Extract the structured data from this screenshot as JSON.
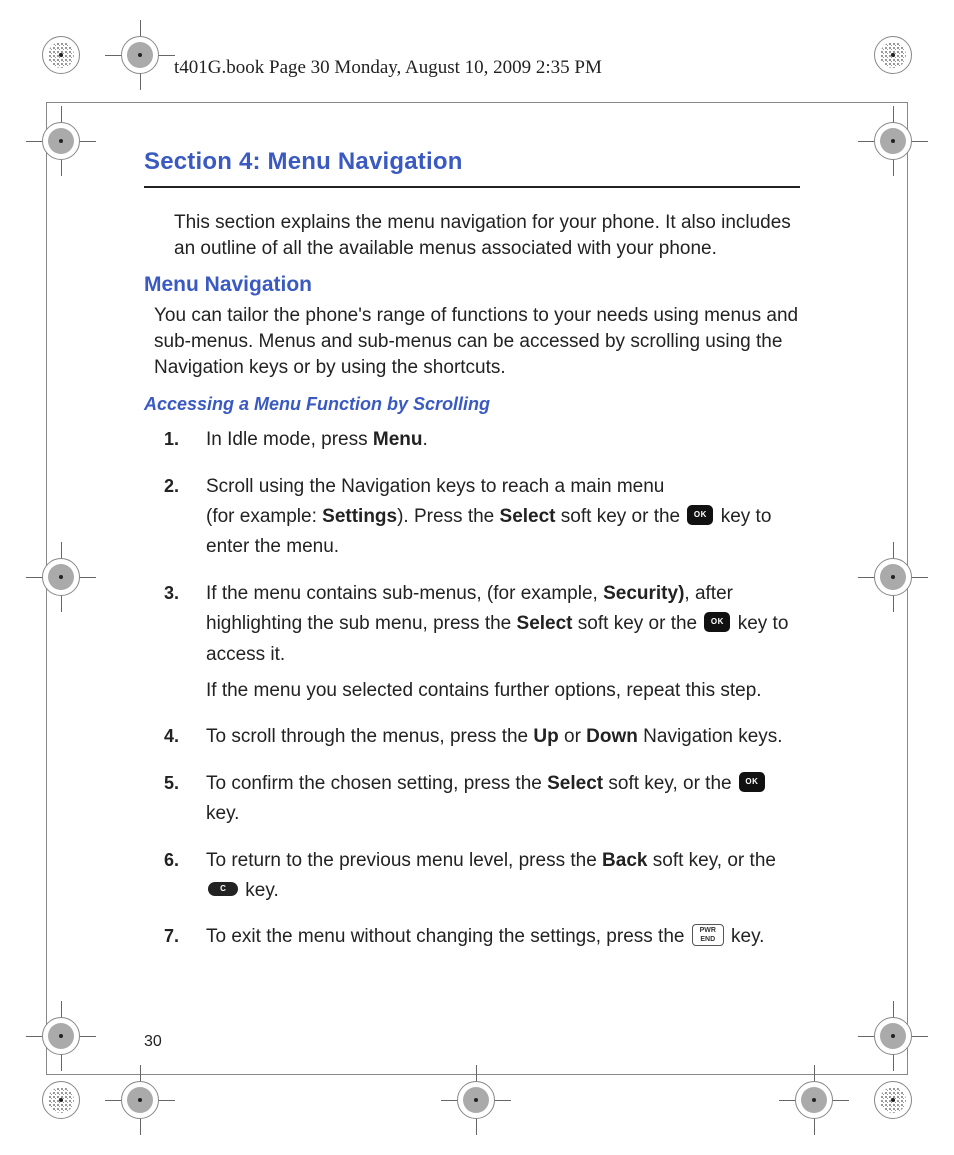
{
  "header_line": "t401G.book  Page 30  Monday, August 10, 2009  2:35 PM",
  "section_title": "Section 4: Menu Navigation",
  "intro": "This section explains the menu navigation for your phone. It also includes an outline of all the available menus associated with your phone.",
  "menu_nav_heading": "Menu Navigation",
  "menu_nav_para": "You can tailor the phone's range of functions to your needs using menus and sub-menus. Menus and sub-menus can be accessed by scrolling using the Navigation keys or by using the shortcuts.",
  "access_heading": "Accessing a Menu Function by Scrolling",
  "steps": {
    "s1": {
      "a": "In Idle mode, press ",
      "b_bold": "Menu",
      "c": "."
    },
    "s2": {
      "a": "Scroll using the Navigation keys to reach a main menu",
      "b": "(for example: ",
      "b_bold": "Settings",
      "c": "). Press the ",
      "c_bold": "Select",
      "d": " soft key or the ",
      "e": " key to enter the menu."
    },
    "s3": {
      "a": "If the menu contains sub-menus, (for example, ",
      "a_bold": "Security)",
      "b": ", after highlighting the sub menu, press the ",
      "b_bold": "Select",
      "c": " soft key or the ",
      "d": " key to access it.",
      "sub": "If the menu you selected contains further options, repeat this step."
    },
    "s4": {
      "a": "To scroll through the menus, press the ",
      "a_bold": "Up",
      "b": " or ",
      "b_bold": "Down",
      "c": " Navigation keys."
    },
    "s5": {
      "a": "To confirm the chosen setting, press the ",
      "a_bold": "Select",
      "b": " soft key, or the ",
      "c": " key."
    },
    "s6": {
      "a": "To return to the previous menu level, press the ",
      "a_bold": "Back",
      "b": " soft key, or the ",
      "c": " key."
    },
    "s7": {
      "a": "To exit the menu without changing the settings, press the ",
      "b": " key."
    }
  },
  "ok_label": "OK",
  "c_label": "C",
  "end_label_top": "PWR",
  "end_label_bottom": "END",
  "page_number": "30"
}
